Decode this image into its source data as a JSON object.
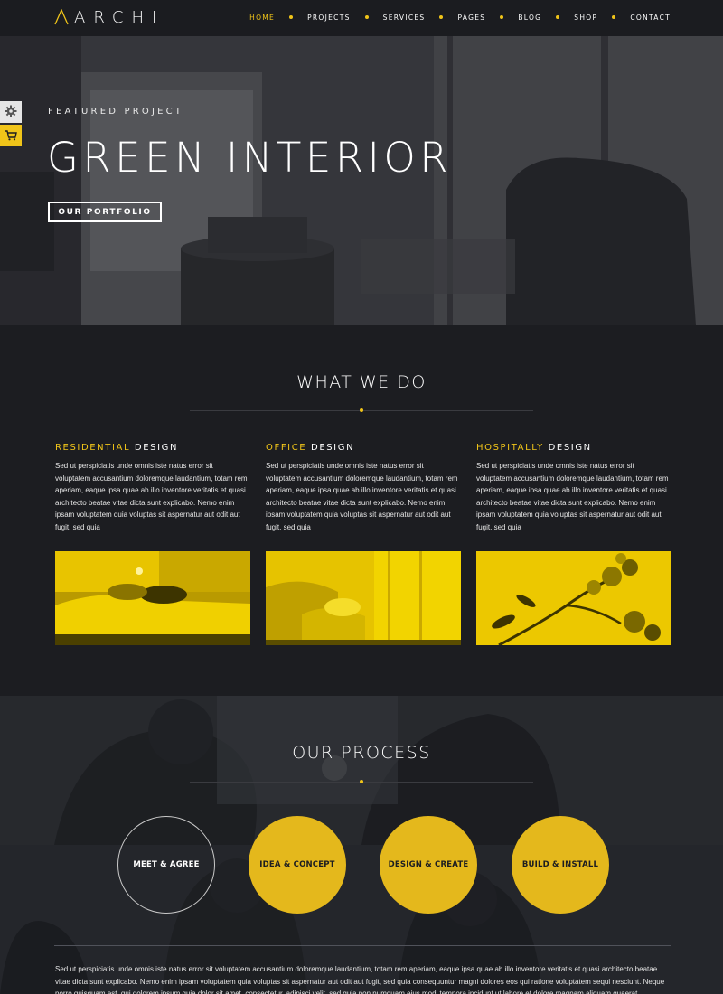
{
  "header": {
    "logo_text": "ARCHI",
    "nav": [
      {
        "label": "HOME",
        "active": true
      },
      {
        "label": "PROJECTS",
        "active": false
      },
      {
        "label": "SERVICES",
        "active": false
      },
      {
        "label": "PAGES",
        "active": false
      },
      {
        "label": "BLOG",
        "active": false
      },
      {
        "label": "SHOP",
        "active": false
      },
      {
        "label": "CONTACT",
        "active": false
      }
    ]
  },
  "side_tools": {
    "settings_icon": "gear-icon",
    "cart_icon": "cart-icon"
  },
  "hero": {
    "eyebrow": "FEATURED PROJECT",
    "title": "GREEN INTERIOR",
    "button_label": "OUR PORTFOLIO"
  },
  "what_we_do": {
    "title": "WHAT WE DO",
    "columns": [
      {
        "highlight": "RESIDENTIAL",
        "rest": "DESIGN",
        "text": "Sed ut perspiciatis unde omnis iste natus error sit voluptatem accusantium doloremque laudantium, totam rem aperiam, eaque ipsa quae ab illo inventore veritatis et quasi architecto beatae vitae dicta sunt explicabo. Nemo enim ipsam voluptatem quia voluptas sit aspernatur aut odit aut fugit, sed quia"
      },
      {
        "highlight": "OFFICE",
        "rest": "DESIGN",
        "text": "Sed ut perspiciatis unde omnis iste natus error sit voluptatem accusantium doloremque laudantium, totam rem aperiam, eaque ipsa quae ab illo inventore veritatis et quasi architecto beatae vitae dicta sunt explicabo. Nemo enim ipsam voluptatem quia voluptas sit aspernatur aut odit aut fugit, sed quia"
      },
      {
        "highlight": "HOSPITALLY",
        "rest": "DESIGN",
        "text": "Sed ut perspiciatis unde omnis iste natus error sit voluptatem accusantium doloremque laudantium, totam rem aperiam, eaque ipsa quae ab illo inventore veritatis et quasi architecto beatae vitae dicta sunt explicabo. Nemo enim ipsam voluptatem quia voluptas sit aspernatur aut odit aut fugit, sed quia"
      }
    ]
  },
  "process": {
    "title": "OUR PROCESS",
    "steps": [
      "MEET & AGREE",
      "IDEA & CONCEPT",
      "DESIGN & CREATE",
      "BUILD & INSTALL"
    ],
    "text": "Sed ut perspiciatis unde omnis iste natus error sit voluptatem accusantium doloremque laudantium, totam rem aperiam, eaque ipsa quae ab illo inventore veritatis et quasi architecto beatae vitae dicta sunt explicabo. Nemo enim ipsam voluptatem quia voluptas sit aspernatur aut odit aut fugit, sed quia consequuntur magni dolores eos qui ratione voluptatem sequi nesciunt. Neque porro quisquam est, qui dolorem ipsum quia dolor sit amet, consectetur, adipisci velit, sed quia non numquam eius modi tempora incidunt ut labore et dolore magnam aliquam quaerat voluptatem. Ut enim"
  },
  "colors": {
    "accent": "#f0c419",
    "background": "#1c1d21",
    "header": "#1b1c20"
  }
}
